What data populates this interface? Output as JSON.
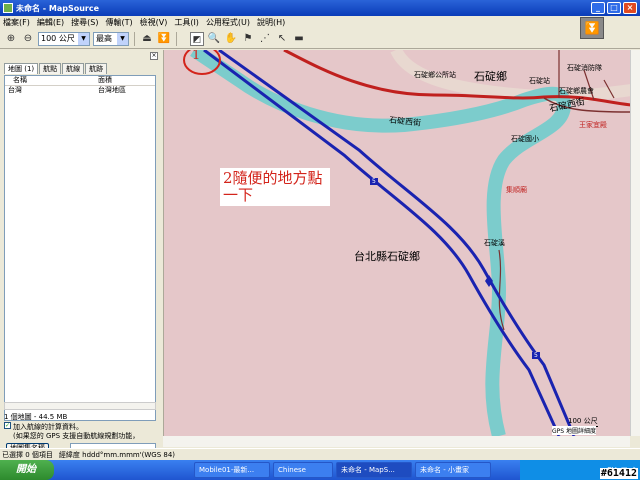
{
  "window": {
    "title": "未命名 - MapSource"
  },
  "menu": [
    "檔案(F)",
    "編輯(E)",
    "搜尋(S)",
    "傳輸(T)",
    "檢視(V)",
    "工具(I)",
    "公用程式(U)",
    "說明(H)"
  ],
  "toolbar": {
    "scale_value": "100 公尺",
    "detail_value": "最高"
  },
  "left_panel": {
    "tabs": [
      "地圖 (1)",
      "航點",
      "航線",
      "航跡"
    ],
    "columns": [
      "名稱",
      "面積"
    ],
    "rows": [
      {
        "name": "台灣",
        "area": "台灣地區"
      }
    ],
    "summary": "1 個地圖 - 44.5 MB",
    "checkbox_label": "加入航線的計算資料。",
    "note": "(如果您的 GPS 支援自動航線規劃功能，",
    "map_name_button": "地圖集名稱"
  },
  "annotations": {
    "step1": "1",
    "step2": "2隨便的地方點一下"
  },
  "map_labels": {
    "town": "石碇鄉",
    "town_office": "石碇鄉公所站",
    "fire_station": "石碇消防隊",
    "station": "石碇站",
    "township_agency": "石碇鄉農會",
    "street1": "石碇西街",
    "street2": "石碇西街",
    "school": "石碇國小",
    "park": "集順廟",
    "residence": "王家宜殿",
    "creek": "石碇溪",
    "county": "台北縣石碇鄉",
    "road_marker1": "5",
    "road_marker2": "5",
    "scale": "100 公尺",
    "gps_note": "GPS 地圖詳細度"
  },
  "status": {
    "selection": "已選擇 0 個項目",
    "coords": "經緯度 hddd°mm.mmm'(WGS 84)"
  },
  "taskbar": {
    "start": "開始",
    "tasks": [
      "Mobile01-最新...",
      "Chinese",
      "未命名 - MapS...",
      "未命名 - 小畫家"
    ],
    "ime": "CH"
  },
  "watermark": "#61412",
  "colors": {
    "map_bg": "#e5c7c9",
    "road_blue": "#1a23b0",
    "river": "#7ccccc",
    "road_red": "#c0201e",
    "annotation_red": "#d3241b"
  }
}
